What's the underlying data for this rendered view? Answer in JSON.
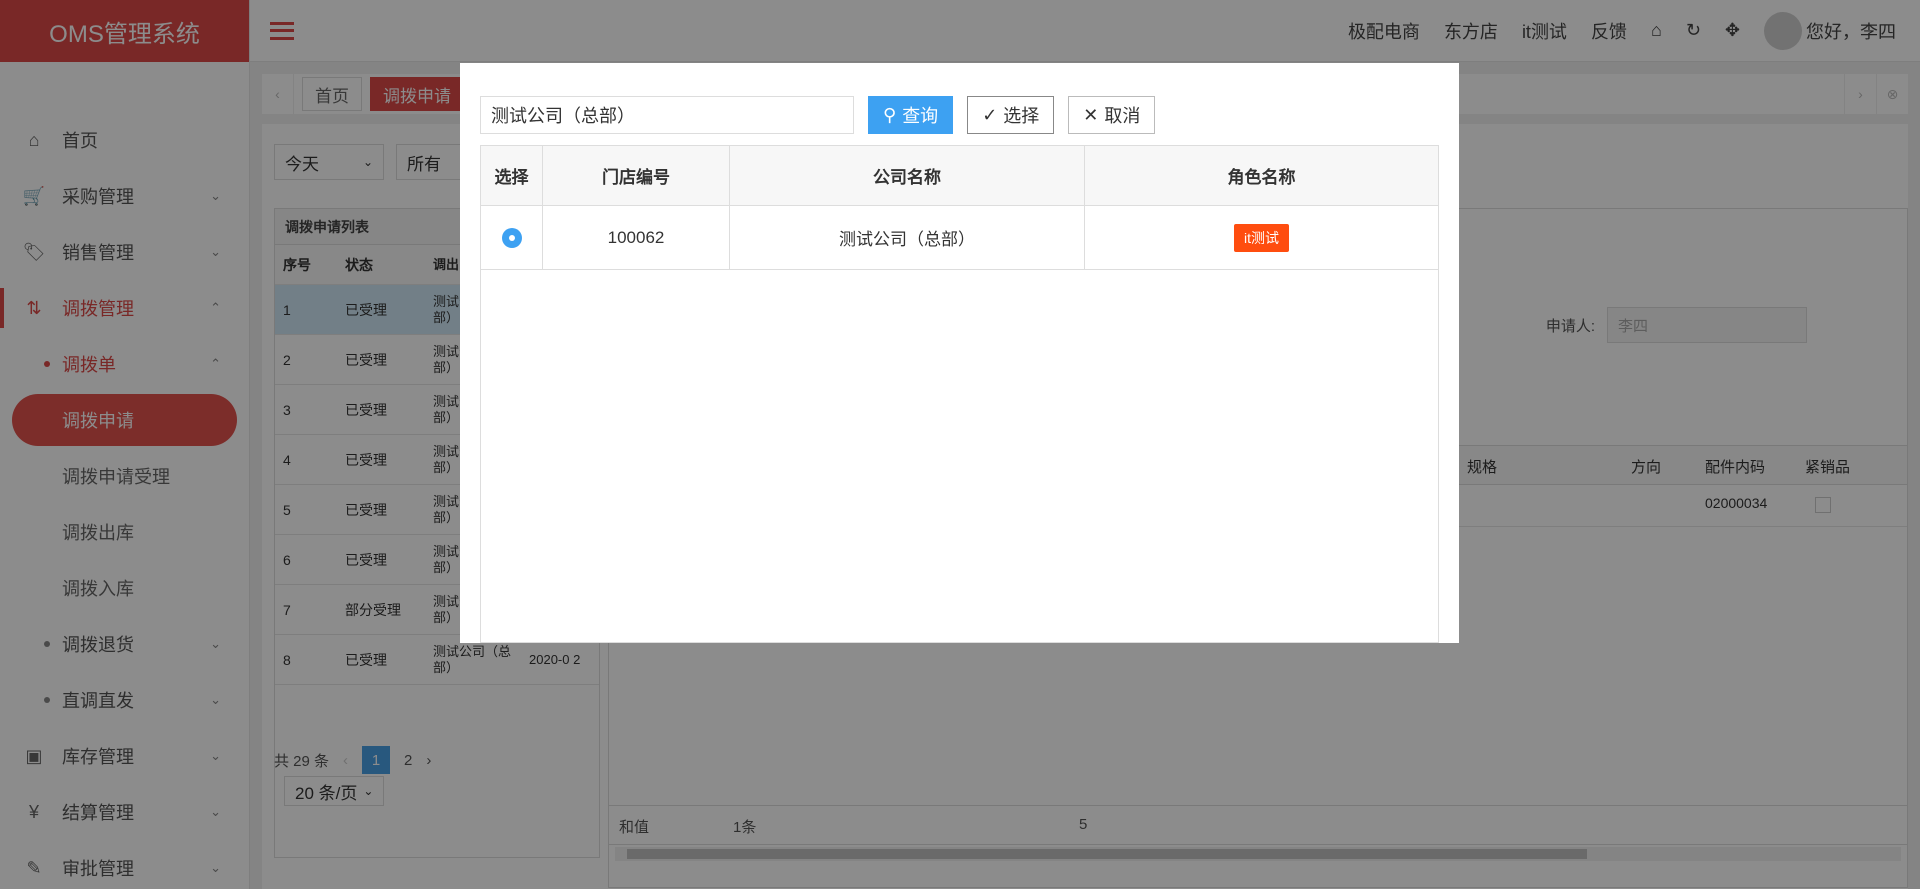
{
  "app": {
    "title": "OMS管理系统"
  },
  "topbar": {
    "links": [
      "极配电商",
      "东方店",
      "it测试",
      "反馈"
    ],
    "greeting": "您好，李四"
  },
  "sidebar": {
    "items": [
      {
        "label": "首页",
        "icon": "home-icon"
      },
      {
        "label": "采购管理",
        "icon": "cart-icon"
      },
      {
        "label": "销售管理",
        "icon": "tag-icon"
      },
      {
        "label": "调拨管理",
        "icon": "transfer-icon"
      },
      {
        "label": "调拨单"
      },
      {
        "label": "调拨申请"
      },
      {
        "label": "调拨申请受理"
      },
      {
        "label": "调拨出库"
      },
      {
        "label": "调拨入库"
      },
      {
        "label": "调拨退货"
      },
      {
        "label": "直调直发"
      },
      {
        "label": "库存管理",
        "icon": "box-icon"
      },
      {
        "label": "结算管理",
        "icon": "yen-icon"
      },
      {
        "label": "审批管理",
        "icon": "brush-icon"
      }
    ]
  },
  "tabs": {
    "home": "首页",
    "current": "调拨申请"
  },
  "filters": {
    "date": "今天",
    "scope": "所有"
  },
  "list": {
    "title": "调拨申请列表",
    "headers": [
      "序号",
      "状态",
      "调出"
    ],
    "rows": [
      {
        "no": "1",
        "status": "已受理",
        "from": "测试公司（总部）",
        "date": ""
      },
      {
        "no": "2",
        "status": "已受理",
        "from": "测试公司（总部）",
        "date": ""
      },
      {
        "no": "3",
        "status": "已受理",
        "from": "测试公司（总部）",
        "date": ""
      },
      {
        "no": "4",
        "status": "已受理",
        "from": "测试公司（总部）",
        "date": ""
      },
      {
        "no": "5",
        "status": "已受理",
        "from": "测试公司（总部）",
        "date": ""
      },
      {
        "no": "6",
        "status": "已受理",
        "from": "测试公司（总部）",
        "date": ""
      },
      {
        "no": "7",
        "status": "部分受理",
        "from": "测试公司（总部）",
        "date": ""
      },
      {
        "no": "8",
        "status": "已受理",
        "from": "测试公司（总部）",
        "date": "2020-0 2"
      }
    ],
    "total": "共 29 条",
    "pages": [
      "1",
      "2"
    ],
    "page_size": "20 条/页"
  },
  "detail": {
    "applicant_label": "申请人:",
    "applicant_value": "李四",
    "grid_headers": [
      "规格",
      "方向",
      "配件内码",
      "紧销品"
    ],
    "grid_row": {
      "code": "02000034"
    },
    "summary": {
      "label": "和值",
      "count": "1条",
      "qty": "5"
    }
  },
  "modal": {
    "search_value": "测试公司（总部）",
    "buttons": {
      "query": "查询",
      "select": "选择",
      "cancel": "取消"
    },
    "headers": {
      "select": "选择",
      "store_no": "门店编号",
      "company": "公司名称",
      "role": "角色名称"
    },
    "rows": [
      {
        "store_no": "100062",
        "company": "测试公司（总部）",
        "role": "it测试"
      }
    ]
  }
}
